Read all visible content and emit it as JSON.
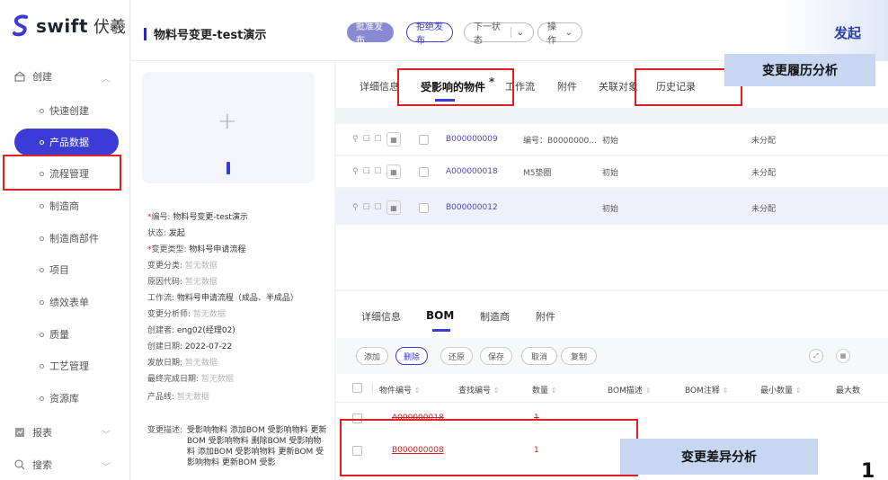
{
  "brand": {
    "name": "swift",
    "sub": "伏羲"
  },
  "sidebar": {
    "group_create": "创建",
    "items": [
      {
        "label": "快速创建"
      },
      {
        "label": "产品数据"
      },
      {
        "label": "流程管理"
      },
      {
        "label": "制造商"
      },
      {
        "label": "制造商部件"
      },
      {
        "label": "项目"
      },
      {
        "label": "绩效表单"
      },
      {
        "label": "质量"
      },
      {
        "label": "工艺管理"
      },
      {
        "label": "资源库"
      }
    ],
    "group_report": "报表",
    "group_search": "搜索"
  },
  "header": {
    "title": "物料号变更-test演示",
    "approve": "批准发布",
    "reject": "拒绝发布",
    "next_state": "下一状态",
    "operate": "操作",
    "launch": "发起"
  },
  "info": {
    "number_label": "编号:",
    "number_value": "物料号变更-test演示",
    "status_label": "状态:",
    "status_value": "发起",
    "change_type_label": "变更类型:",
    "change_type_value": "物料号申请流程",
    "change_cat_label": "变更分类:",
    "no_data": "暂无数据",
    "reason_label": "原因代码:",
    "workflow_label": "工作流:",
    "workflow_value": "物料号申请流程（成品、半成品）",
    "analyst_label": "变更分析师:",
    "creator_label": "创建者:",
    "creator_value": "eng02(经理02)",
    "created_label": "创建日期:",
    "created_value": "2022-07-22",
    "release_label": "发放日期:",
    "final_label": "最终完成日期:",
    "line_label": "产品线:",
    "desc_label": "变更描述:",
    "desc_value": "受影响物料 添加BOM 受影响物料 更新BOM 受影响物料 删除BOM 受影响物料 添加BOM 受影响物料 更新BOM 受影响物料 更新BOM 受影"
  },
  "tabs": {
    "detail": "详细信息",
    "affected": "受影响的物件",
    "star": "*",
    "workflow": "工作流",
    "attachment": "附件",
    "related": "关联对象",
    "history": "历史记录"
  },
  "affected_rows": [
    {
      "code": "B000000009",
      "name": "编号：B0000000...",
      "state": "初始",
      "assign": "未分配"
    },
    {
      "code": "A000000018",
      "name": "M5垫圈",
      "state": "初始",
      "assign": "未分配"
    },
    {
      "code": "B000000012",
      "name": "",
      "state": "初始",
      "assign": "未分配"
    }
  ],
  "row_icons": "⚲ ☐ ☐",
  "grid_glyph": "▦",
  "bom_tabs": {
    "detail": "详细信息",
    "bom": "BOM",
    "maker": "制造商",
    "attachment": "附件"
  },
  "toolbar": {
    "add": "添加",
    "delete": "删除",
    "restore": "还原",
    "save": "保存",
    "cancel": "取消",
    "copy": "复制"
  },
  "bom_columns": {
    "code": "物件编号",
    "find": "查找编号",
    "qty": "数量",
    "desc": "BOM描述",
    "note": "BOM注释",
    "min": "最小数量",
    "max": "最大数"
  },
  "sort_glyph": "⇕",
  "bom_rows": [
    {
      "code": "A000000018",
      "qty": "1"
    },
    {
      "code": "B000000008",
      "qty": "1"
    }
  ],
  "annotations": {
    "history_analysis": "变更履历分析",
    "diff_analysis": "变更差异分析",
    "page_number": "1"
  },
  "colors": {
    "primary": "#3b3bd6",
    "annotation_red": "#e02020",
    "annotation_bg": "#c7d7f1"
  }
}
